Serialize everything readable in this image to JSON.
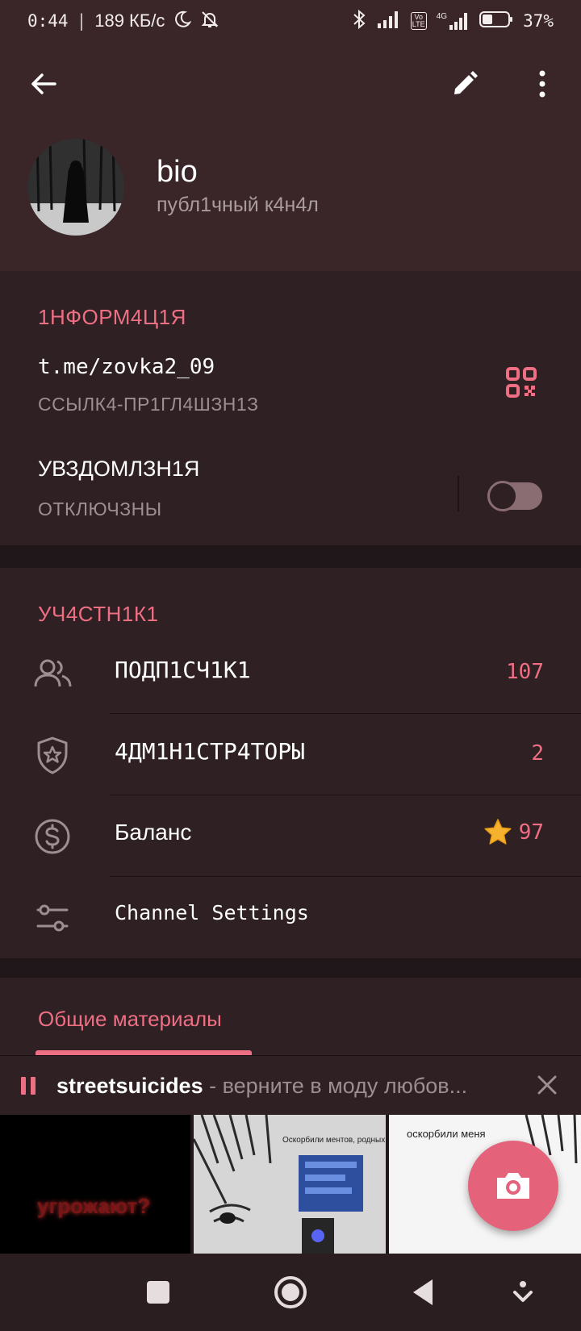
{
  "status_bar": {
    "time": "0:44",
    "speed": "189 КБ/с",
    "network": "4G",
    "volte": "Vo LTE",
    "battery": "37%"
  },
  "header": {
    "title": "bio",
    "subtitle": "публ1чный к4н4л"
  },
  "info": {
    "section_title": "1НФОРМ4Ц1Я",
    "link": "t.me/zovka2_09",
    "link_caption": "ССЫЛК4-ПР1ГЛ4ШЗН1З",
    "notifications_label": "УВЗДОМЛЗН1Я",
    "notifications_state": "ОТКЛЮЧЗНЫ",
    "notifications_on": false
  },
  "members": {
    "section_title": "УЧ4СТН1К1",
    "items": [
      {
        "icon": "users-icon",
        "label": "ПОДП1СЧ1К1",
        "value": "107"
      },
      {
        "icon": "shield-star-icon",
        "label": "4ДМ1Н1СТР4ТОРЫ",
        "value": "2"
      },
      {
        "icon": "dollar-coin-icon",
        "label": "Баланс",
        "value": "97"
      },
      {
        "icon": "sliders-icon",
        "label": "Channel Settings",
        "value": ""
      }
    ]
  },
  "media": {
    "tab_label": "Общие материалы",
    "thumb1_text": "угрожают?",
    "thumb2_text": "Оскорбили ментов, родных",
    "thumb3_text": "оскорбили меня"
  },
  "player": {
    "artist": "streetsuicides",
    "separator": " - ",
    "song": "верните в моду любов..."
  },
  "colors": {
    "accent": "#ee6e83",
    "header_bg": "#3a2529",
    "section_bg": "#2e2023",
    "fab": "#e4637a"
  }
}
